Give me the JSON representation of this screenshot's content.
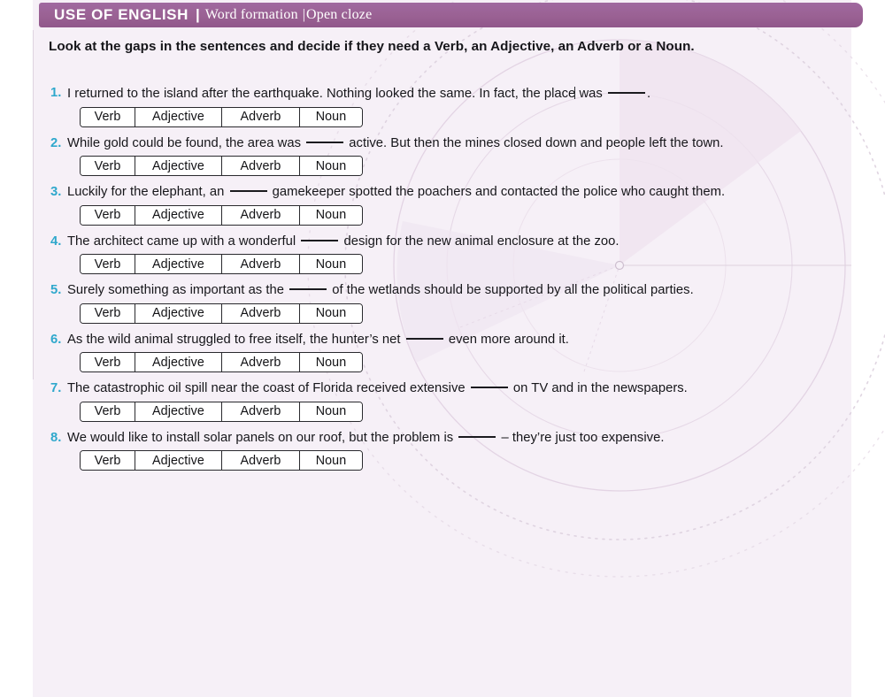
{
  "header": {
    "title": "USE OF ENGLISH",
    "separator": "|",
    "subtitle": "Word formation",
    "separator2": "|",
    "subtitle2": "Open cloze",
    "band_color": "#9a6193",
    "text_color": "#ffffff"
  },
  "instruction": "Look at the gaps in the sentences and decide if they need a Verb, an Adjective, an Adverb or a Noun.",
  "theme": {
    "panel_background": "#f6f0f7",
    "page_background": "#ffffff",
    "number_color": "#2fa8cc",
    "body_text_color": "#16161a",
    "option_border_color": "#2a2a2e",
    "option_fill": "#ffffff"
  },
  "options": {
    "labels": [
      "Verb",
      "Adjective",
      "Adverb",
      "Noun"
    ]
  },
  "questions": [
    {
      "number": "1.",
      "before": "I returned to the island after the earthquake. Nothing looked the same. In fact, the place was ",
      "after": "."
    },
    {
      "number": "2.",
      "before": "While gold could be found, the area was ",
      "after": " active. But then the mines closed down and people left the town."
    },
    {
      "number": "3.",
      "before": "Luckily for the elephant, an ",
      "after": " gamekeeper spotted the poachers and contacted the police who caught them."
    },
    {
      "number": "4.",
      "before": "The architect came up with a wonderful ",
      "after": " design for the new animal enclosure at the zoo."
    },
    {
      "number": "5.",
      "before": "Surely something as important as the ",
      "after": " of the wetlands should be supported by all the political parties."
    },
    {
      "number": "6.",
      "before": "As the wild animal struggled to free itself, the hunter’s net ",
      "after": " even more around it."
    },
    {
      "number": "7.",
      "before": "The catastrophic oil spill near the coast of Florida received extensive ",
      "after": " on TV and in the newspapers."
    },
    {
      "number": "8.",
      "before": "We would like to install solar panels on our roof, but the problem is ",
      "after": " – they’re just too expensive."
    }
  ]
}
